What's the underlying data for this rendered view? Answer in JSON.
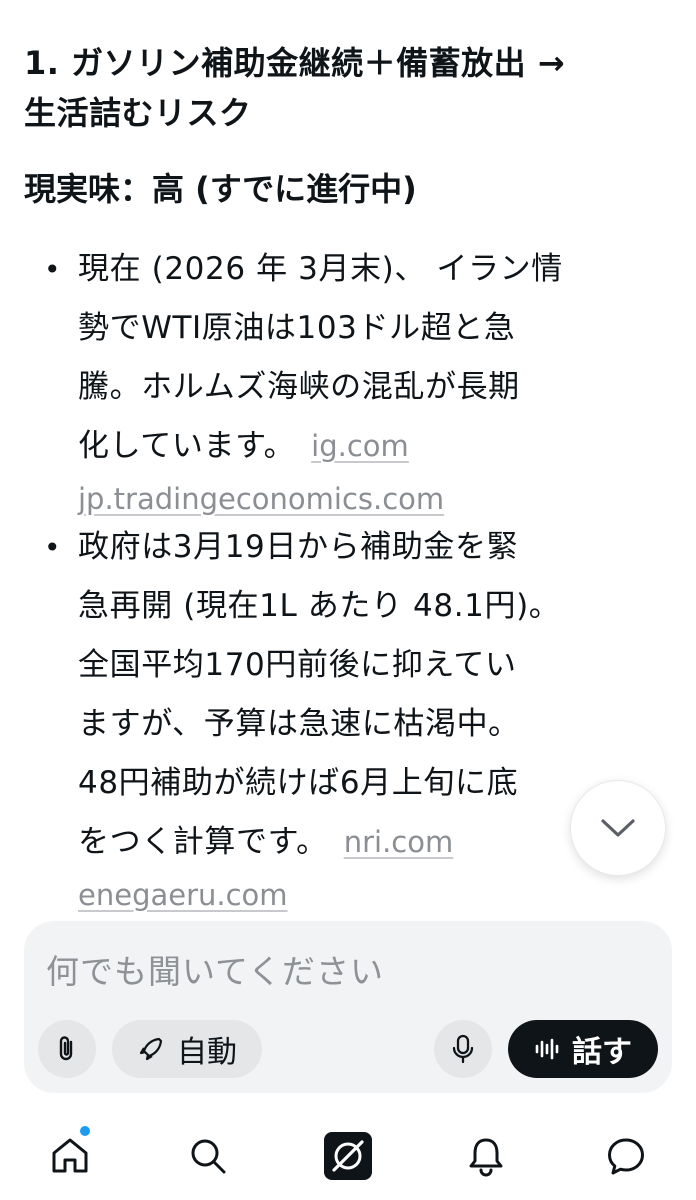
{
  "heading": {
    "line1": "1. ガソリン補助金継続＋備蓄放出 →",
    "line2": "生活詰むリスク"
  },
  "subheading": "現実味：高 (すでに進行中)",
  "bullets": [
    {
      "lines": [
        "現在 (2026 年 3月末)、 イラン情",
        "勢でWTI原油は103ドル超と急",
        "騰。ホルムズ海峡の混乱が長期",
        "化しています。"
      ],
      "sources": [
        "ig.com",
        "jp.tradingeconomics.com"
      ]
    },
    {
      "lines": [
        "政府は3月19日から補助金を緊",
        "急再開 (現在1L あたり 48.1円)。",
        "全国平均170円前後に抑えてい",
        "ますが、予算は急速に枯渇中。",
        "48円補助が続けば6月上旬に底",
        "をつく計算です。"
      ],
      "sources": [
        "nri.com",
        "enegaeru.com"
      ]
    }
  ],
  "composer": {
    "placeholder": "何でも聞いてください",
    "auto_label": "自動",
    "speak_label": "話す"
  },
  "icons": {
    "scroll": "chevron-down-icon",
    "attach": "paperclip-icon",
    "auto": "rocket-icon",
    "mic": "mic-icon",
    "speak": "waveform-icon",
    "nav": [
      "home-icon",
      "search-icon",
      "grok-icon",
      "bell-icon",
      "chat-icon"
    ]
  },
  "colors": {
    "text": "#0f1419",
    "link": "#8b8f93",
    "accent_dot": "#1d9bf0"
  }
}
